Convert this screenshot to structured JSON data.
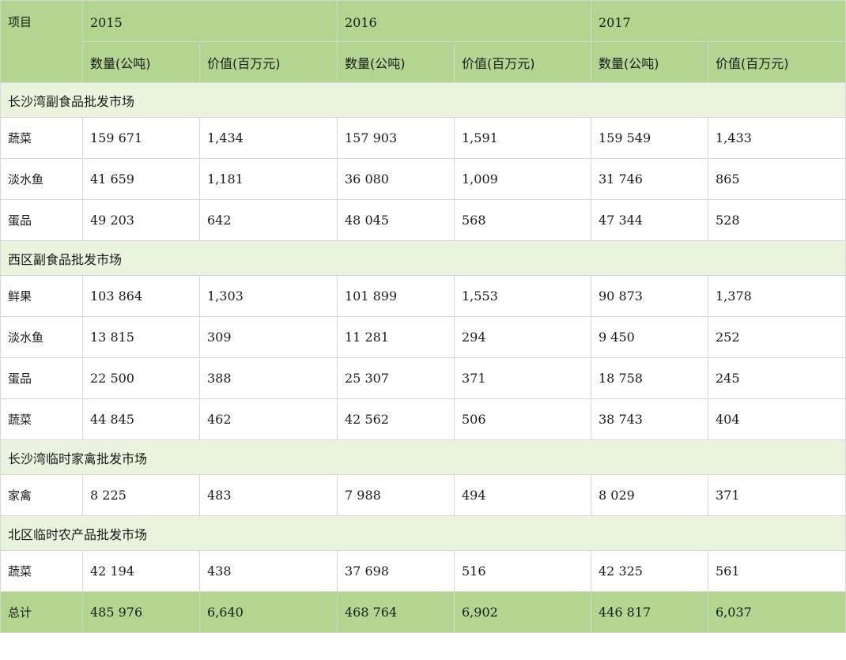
{
  "header": {
    "item_label": "项目",
    "years": [
      "2015",
      "2016",
      "2017"
    ],
    "qty_label": "数量(公吨)",
    "val_label": "价值(百万元)"
  },
  "sections": [
    {
      "name": "长沙湾副食品批发市场",
      "rows": [
        {
          "item": "蔬菜",
          "values": [
            "159 671",
            "1,434",
            "157 903",
            "1,591",
            "159 549",
            "1,433"
          ]
        },
        {
          "item": "淡水鱼",
          "values": [
            "41 659",
            "1,181",
            "36 080",
            "1,009",
            "31 746",
            "865"
          ]
        },
        {
          "item": "蛋品",
          "values": [
            "49 203",
            "642",
            "48 045",
            "568",
            "47 344",
            "528"
          ]
        }
      ]
    },
    {
      "name": "西区副食品批发市场",
      "rows": [
        {
          "item": "鲜果",
          "values": [
            "103 864",
            "1,303",
            "101 899",
            "1,553",
            "90 873",
            "1,378"
          ]
        },
        {
          "item": "淡水鱼",
          "values": [
            "13 815",
            "309",
            "11 281",
            "294",
            "9 450",
            "252"
          ]
        },
        {
          "item": "蛋品",
          "values": [
            "22 500",
            "388",
            "25 307",
            "371",
            "18 758",
            "245"
          ]
        },
        {
          "item": "蔬菜",
          "values": [
            "44 845",
            "462",
            "42 562",
            "506",
            "38 743",
            "404"
          ]
        }
      ]
    },
    {
      "name": "长沙湾临时家禽批发市场",
      "rows": [
        {
          "item": "家禽",
          "values": [
            "8 225",
            "483",
            "7 988",
            "494",
            "8 029",
            "371"
          ]
        }
      ]
    },
    {
      "name": "北区临时农产品批发市场",
      "rows": [
        {
          "item": "蔬菜",
          "values": [
            "42 194",
            "438",
            "37 698",
            "516",
            "42 325",
            "561"
          ]
        }
      ]
    }
  ],
  "total": {
    "item": "总计",
    "values": [
      "485 976",
      "6,640",
      "468 764",
      "6,902",
      "446 817",
      "6,037"
    ]
  }
}
